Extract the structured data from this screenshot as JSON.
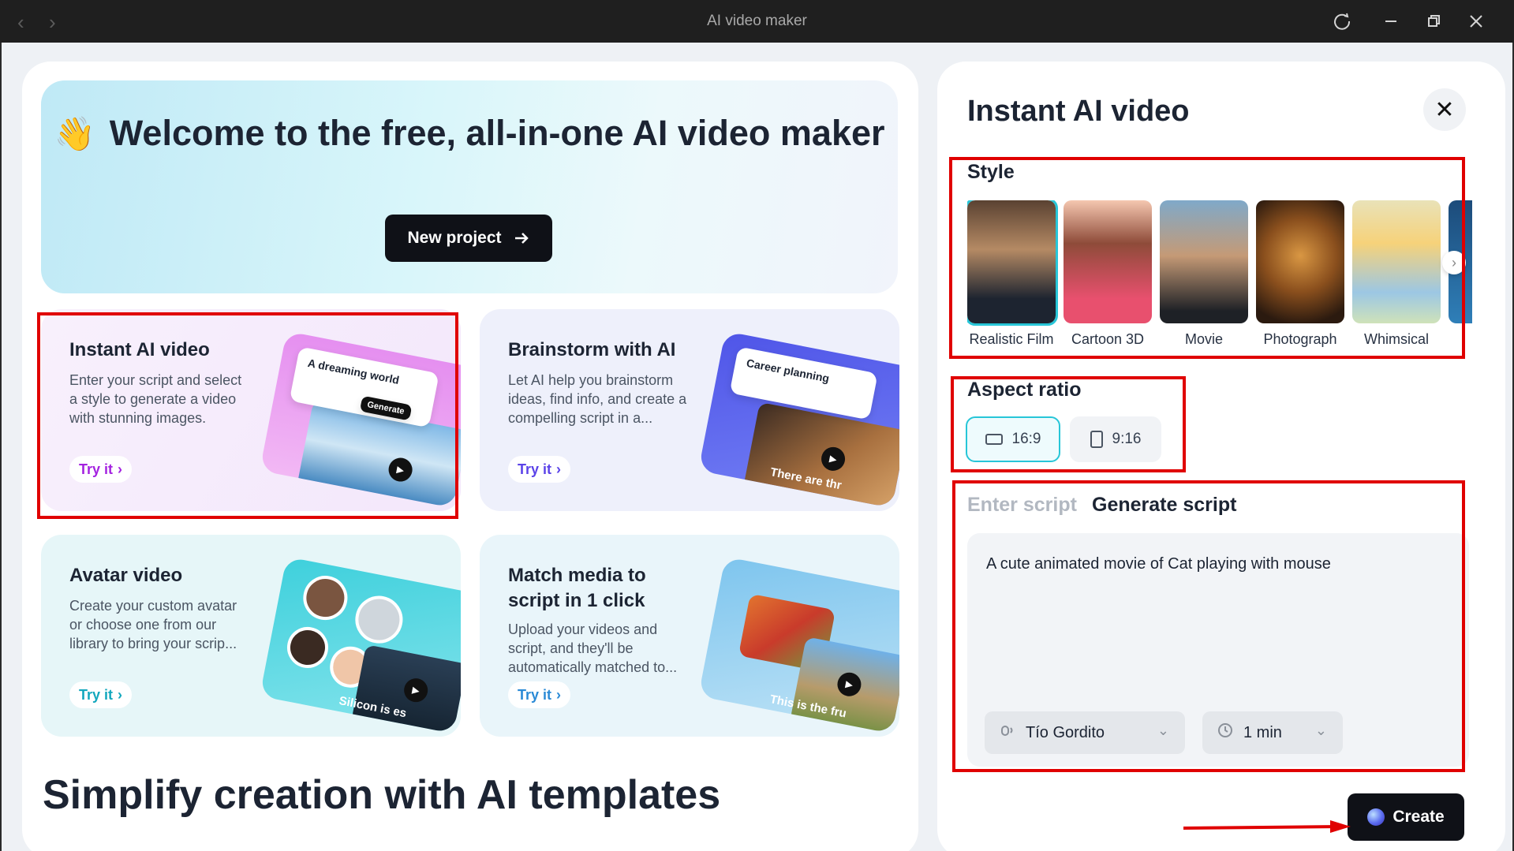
{
  "window": {
    "title": "AI video maker",
    "back_glyph": "‹",
    "forward_glyph": "›"
  },
  "hero": {
    "emoji": "👋",
    "title": "Welcome to the free, all-in-one AI video maker",
    "new_project_label": "New project"
  },
  "cards": [
    {
      "title": "Instant AI video",
      "desc": "Enter your script and select a style to generate a video with stunning images.",
      "try_label": "Try it",
      "art_caption": "A dreaming world",
      "art_button": "Generate"
    },
    {
      "title": "Brainstorm with AI",
      "desc": "Let AI help you brainstorm ideas, find info, and create a compelling script in a...",
      "try_label": "Try it",
      "art_caption": "Career planning",
      "art_footer": "There are thr"
    },
    {
      "title": "Avatar video",
      "desc": "Create your custom avatar or choose one from our library to bring your scrip...",
      "try_label": "Try it",
      "art_footer": "Silicon is es"
    },
    {
      "title": "Match media to script in 1 click",
      "desc": "Upload your videos and script, and they'll be automatically matched to...",
      "try_label": "Try it",
      "art_footer": "This is the fru"
    }
  ],
  "templates_title": "Simplify creation with AI templates",
  "panel": {
    "title": "Instant AI video",
    "style_label": "Style",
    "styles": [
      {
        "name": "Realistic Film",
        "selected": true
      },
      {
        "name": "Cartoon 3D",
        "selected": false
      },
      {
        "name": "Movie",
        "selected": false
      },
      {
        "name": "Photograph",
        "selected": false
      },
      {
        "name": "Whimsical",
        "selected": false
      }
    ],
    "aspect_label": "Aspect ratio",
    "aspect_options": [
      {
        "label": "16:9",
        "selected": true
      },
      {
        "label": "9:16",
        "selected": false
      }
    ],
    "tab_enter": "Enter script",
    "tab_generate": "Generate script",
    "script_text": "A cute animated movie of Cat playing with mouse",
    "voice": "Tío Gordito",
    "duration": "1 min",
    "create_label": "Create"
  },
  "colors": {
    "accent": "#27c6d8",
    "annotation_red": "#e00000",
    "dark_button": "#0f1117"
  }
}
